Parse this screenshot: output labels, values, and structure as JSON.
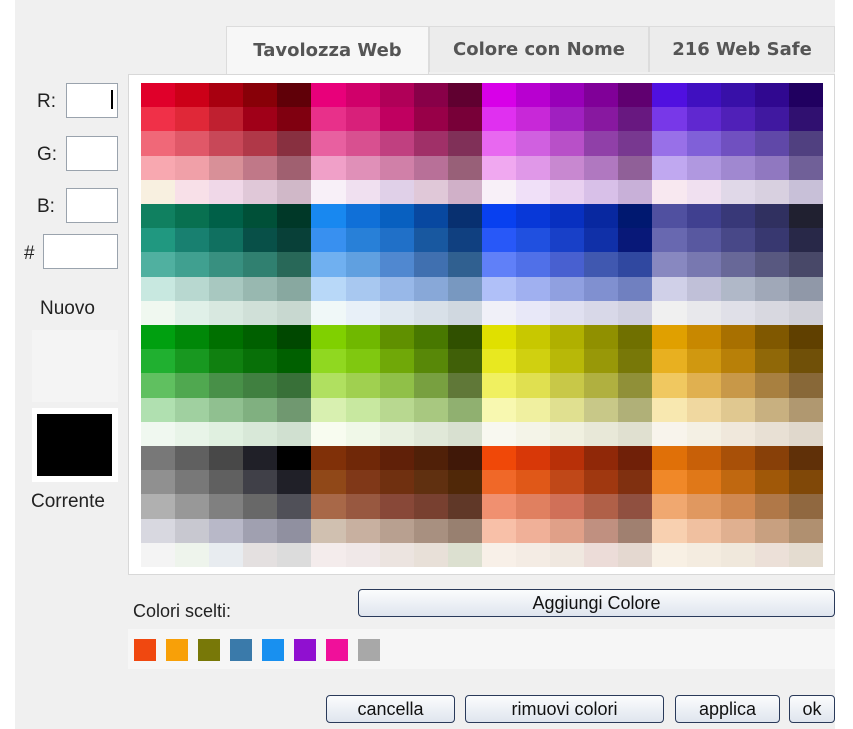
{
  "tabs": [
    {
      "label": "Tavolozza Web"
    },
    {
      "label": "Colore con Nome"
    },
    {
      "label": "216 Web Safe"
    }
  ],
  "fields": {
    "r_label": "R:",
    "g_label": "G:",
    "b_label": "B:",
    "hex_label": "#",
    "r_value": "",
    "g_value": "",
    "b_value": "",
    "hex_value": ""
  },
  "preview": {
    "new_label": "Nuovo",
    "current_label": "Corrente",
    "new_color": "#f4f4f4",
    "current_color": "#000000"
  },
  "chosen": {
    "label": "Colori scelti:",
    "add_button": "Aggiungi Colore",
    "colors": [
      "#f04810",
      "#f8a008",
      "#787808",
      "#3a7aaa",
      "#1890f0",
      "#9010d0",
      "#f0109a",
      "#a8a8a8"
    ]
  },
  "buttons": {
    "cancel": "cancella",
    "remove": "rimuovi colori",
    "apply": "applica",
    "ok": "ok"
  },
  "palette_rows": [
    [
      "#e0002a",
      "#cc0018",
      "#a80010",
      "#880008",
      "#600008",
      "#e8007a",
      "#d0006a",
      "#b00058",
      "#880048",
      "#600030",
      "#d800e8",
      "#b800d0",
      "#9800b8",
      "#800098",
      "#600070",
      "#5010e0",
      "#4010c0",
      "#3810a8",
      "#300890",
      "#200060"
    ],
    [
      "#f03048",
      "#e02838",
      "#c02030",
      "#a00018",
      "#800010",
      "#e8308a",
      "#d8207a",
      "#c00060",
      "#980048",
      "#780038",
      "#e030f0",
      "#c828d8",
      "#a020c0",
      "#8818a0",
      "#681880",
      "#7838e8",
      "#6028d0",
      "#5020b8",
      "#4018a0",
      "#301070"
    ],
    [
      "#f06878",
      "#e05868",
      "#c84858",
      "#b03848",
      "#883040",
      "#e860a0",
      "#d85090",
      "#c04080",
      "#a03068",
      "#803058",
      "#e868f0",
      "#d060e0",
      "#b850c8",
      "#9040a8",
      "#783890",
      "#9870e8",
      "#8060d8",
      "#7050c0",
      "#6048a8",
      "#504080"
    ],
    [
      "#f8a8b0",
      "#f0a0a8",
      "#d89098",
      "#c07888",
      "#a06070",
      "#f0a0c8",
      "#e090b8",
      "#d080a8",
      "#b87098",
      "#986078",
      "#f0a8f0",
      "#e098e8",
      "#c888d0",
      "#b078c0",
      "#906098",
      "#c0a8f0",
      "#b098e0",
      "#a088d0",
      "#9078c0",
      "#706098"
    ],
    [
      "#f8f0e0",
      "#f8e0e8",
      "#f0d8e8",
      "#e0c8d8",
      "#d0b8c8",
      "#f8f0f8",
      "#f0e0f0",
      "#e0d0e8",
      "#e0c8d8",
      "#d0b0c8",
      "#f8f0f8",
      "#f0e0f8",
      "#e8d0f0",
      "#d8c0e8",
      "#c8b0d8",
      "#f8e8f0",
      "#f0e0f0",
      "#e0d8e8",
      "#d8d0e0",
      "#c8c0d8"
    ],
    [
      "#108060",
      "#087050",
      "#006048",
      "#005038",
      "#003828",
      "#1888f0",
      "#1070d8",
      "#0860c0",
      "#0848a0",
      "#083070",
      "#0840f0",
      "#0838d8",
      "#0830c0",
      "#0828a0",
      "#001870",
      "#5050a0",
      "#404090",
      "#383878",
      "#303060",
      "#202030"
    ],
    [
      "#209880",
      "#188070",
      "#107060",
      "#085048",
      "#084038",
      "#3890f0",
      "#2880d8",
      "#2070c8",
      "#1858a0",
      "#104080",
      "#2858f8",
      "#2050e0",
      "#1840c8",
      "#1030a8",
      "#081878",
      "#6868b0",
      "#5858a0",
      "#484888",
      "#383870",
      "#282848"
    ],
    [
      "#50b0a0",
      "#40a090",
      "#389080",
      "#308070",
      "#286858",
      "#70b0f0",
      "#60a0e0",
      "#5088d0",
      "#4070b0",
      "#306090",
      "#6080f8",
      "#5070e8",
      "#4860d0",
      "#4058b0",
      "#3048a0",
      "#8888c0",
      "#7878b0",
      "#686898",
      "#585880",
      "#484868"
    ],
    [
      "#c8e8e0",
      "#b8d8d0",
      "#a8c8c0",
      "#98b8b0",
      "#88a8a0",
      "#b8d8f8",
      "#a8c8f0",
      "#98b8e8",
      "#88a8d8",
      "#7898c0",
      "#b0c0f8",
      "#a0b0f0",
      "#90a0e0",
      "#8090d0",
      "#7080c0",
      "#d0d0e8",
      "#c0c0d8",
      "#b0b8c8",
      "#a0a8b8",
      "#9098a8"
    ],
    [
      "#f0f8f0",
      "#e0f0e8",
      "#d8e8e0",
      "#d0e0d8",
      "#c8d8d0",
      "#f0f8f8",
      "#e8f0f8",
      "#e0e8f0",
      "#d8e0e8",
      "#d0d8e0",
      "#f0f0f8",
      "#e8e8f8",
      "#e0e0f0",
      "#d8d8e8",
      "#d0d0e0",
      "#f0f0f0",
      "#e8e8ec",
      "#e0e0e8",
      "#d8d8e0",
      "#d0d0d8"
    ],
    [
      "#00a010",
      "#008808",
      "#007000",
      "#006000",
      "#004800",
      "#80d000",
      "#70b800",
      "#609000",
      "#487800",
      "#305000",
      "#e0e000",
      "#c8c800",
      "#b0b000",
      "#909000",
      "#707000",
      "#e0a000",
      "#c88800",
      "#a87000",
      "#805800",
      "#604000"
    ],
    [
      "#20b030",
      "#189820",
      "#108010",
      "#087008",
      "#006000",
      "#90d820",
      "#80c810",
      "#70a808",
      "#588808",
      "#406008",
      "#e8e820",
      "#d0d010",
      "#b8b808",
      "#989808",
      "#787808",
      "#e8b020",
      "#d09810",
      "#b88008",
      "#906808",
      "#705008"
    ],
    [
      "#60c060",
      "#50a850",
      "#489048",
      "#408040",
      "#387038",
      "#b0e060",
      "#a0d050",
      "#90c048",
      "#78a040",
      "#607838",
      "#f0f060",
      "#e0e050",
      "#c8c848",
      "#b0b040",
      "#909038",
      "#f0c860",
      "#e0b050",
      "#c89848",
      "#a88040",
      "#886838"
    ],
    [
      "#b0e0b0",
      "#a0d0a0",
      "#90c090",
      "#80b080",
      "#709870",
      "#d8f0b0",
      "#c8e8a0",
      "#b8d890",
      "#a8c880",
      "#90b070",
      "#f8f8b0",
      "#f0f0a0",
      "#e0e090",
      "#c8c888",
      "#b0b078",
      "#f8e8b0",
      "#f0d8a0",
      "#e0c890",
      "#c8b080",
      "#b09870"
    ],
    [
      "#f0f8f0",
      "#e8f4e8",
      "#e0f0e0",
      "#d8e8d8",
      "#d0e0d0",
      "#f8fcf0",
      "#f0f8e8",
      "#e8f0e0",
      "#e0e8d8",
      "#d8e0d0",
      "#f8f8f0",
      "#f4f4e8",
      "#f0f0e0",
      "#e8e8d8",
      "#e0e0d0",
      "#f8f4ec",
      "#f4f0e4",
      "#f0e8dc",
      "#e8e0d4",
      "#e0d8cc"
    ],
    [
      "#787878",
      "#606060",
      "#484848",
      "#202028",
      "#000000",
      "#803008",
      "#702808",
      "#602008",
      "#502008",
      "#401808",
      "#f04808",
      "#d83808",
      "#b83008",
      "#902808",
      "#702008",
      "#e07008",
      "#c86008",
      "#a85008",
      "#884008",
      "#603008"
    ],
    [
      "#909090",
      "#787878",
      "#606060",
      "#404048",
      "#202028",
      "#904818",
      "#803818",
      "#703010",
      "#603010",
      "#502808",
      "#f06828",
      "#e05818",
      "#c04818",
      "#a03810",
      "#803010",
      "#f08828",
      "#e07818",
      "#c06810",
      "#a05808",
      "#804808"
    ],
    [
      "#b0b0b0",
      "#989898",
      "#808080",
      "#686868",
      "#505058",
      "#a86848",
      "#985840",
      "#884838",
      "#784030",
      "#603828",
      "#f09070",
      "#e08060",
      "#d07058",
      "#b06048",
      "#905040",
      "#f0a870",
      "#e09860",
      "#d08850",
      "#b07848",
      "#906840"
    ],
    [
      "#d8d8e0",
      "#c8c8d0",
      "#b8b8c8",
      "#a0a0b0",
      "#9090a0",
      "#d0c0b0",
      "#c8b0a0",
      "#b8a090",
      "#a89080",
      "#988070",
      "#f8c0a8",
      "#f0b098",
      "#e0a088",
      "#c09080",
      "#a08070",
      "#f8d0b0",
      "#f0c0a0",
      "#e0b090",
      "#c8a080",
      "#b09070"
    ],
    [
      "#f4f4f4",
      "#eef4ec",
      "#e8ecf0",
      "#e4e0e0",
      "#dcdcdc",
      "#f4ecec",
      "#f0e8e8",
      "#ece4e0",
      "#e8e0d8",
      "#dce0d0",
      "#f8f0e8",
      "#f4ece4",
      "#f0e8e0",
      "#ecdcd8",
      "#e4d8d0",
      "#f8f0e4",
      "#f4ece0",
      "#f0e8dc",
      "#ece0d8",
      "#e4dcd0"
    ]
  ]
}
